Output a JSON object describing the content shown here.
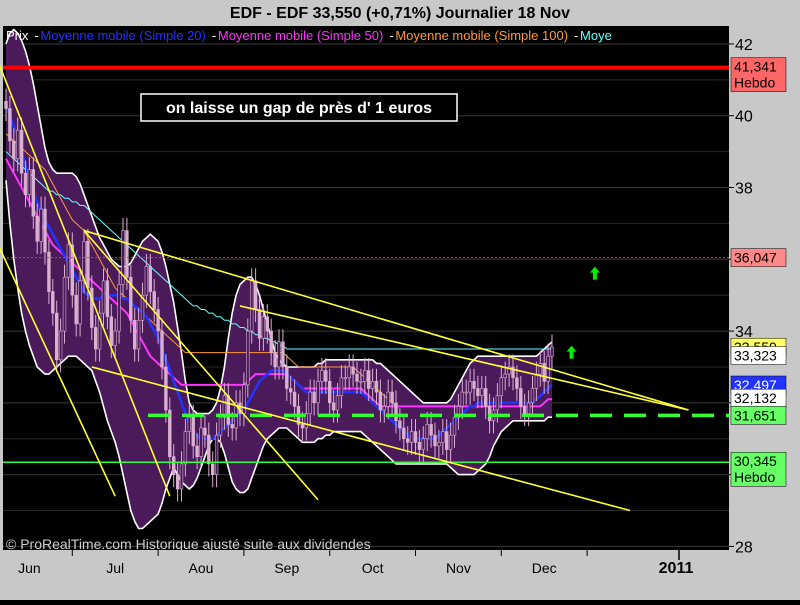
{
  "header": {
    "title": "EDF - EDF     33,550 (+0,71%)     Journalier  18 Nov"
  },
  "legend_items": [
    {
      "label": "Prix",
      "color": "#ffffff"
    },
    {
      "label": "Moyenne mobile (Simple 20)",
      "color": "#2233ff"
    },
    {
      "label": "Moyenne mobile (Simple 50)",
      "color": "#ff33ff"
    },
    {
      "label": "Moyenne mobile (Simple 100)",
      "color": "#ff9933"
    },
    {
      "label": "Moye",
      "color": "#66ffff"
    }
  ],
  "annotation": "on laisse un gap de près d' 1 euros",
  "footer": "© ProRealTime.com Historique ajusté suite aux dividendes",
  "colors": {
    "background": "#000000",
    "frame": "#c8c8c8",
    "band_fill": "#4a1a5a",
    "band_edge": "#ffffff",
    "candle": "#d9b0d0",
    "trendline": "#ffff33",
    "support": "#33ff33",
    "resistance_solid": "#ff0000",
    "resistance_dotted": "#ff3333",
    "ma20": "#2233ff",
    "ma50": "#ff33ff",
    "ma100": "#ff9933",
    "ma200": "#66ffff"
  },
  "chart_data": {
    "type": "candlestick",
    "instrument": "EDF",
    "last_price": 33.55,
    "change_pct": 0.71,
    "period": "Journalier",
    "date": "18 Nov",
    "x_tick_labels": [
      "Jun",
      "Jul",
      "Aou",
      "Sep",
      "Oct",
      "Nov",
      "Dec",
      "2011"
    ],
    "y_tick_labels": [
      "28",
      "30",
      "32",
      "34",
      "36",
      "38",
      "40",
      "42"
    ],
    "ylim": [
      27.9,
      42.5
    ],
    "price_labels": [
      {
        "value": 41.341,
        "text": "41,341",
        "sub": "Hebdo",
        "bg": "#ff6666"
      },
      {
        "value": 36.047,
        "text": "36,047",
        "sub": "",
        "bg": "#ff8888"
      },
      {
        "value": 33.55,
        "text": "33,550",
        "sub": "",
        "bg": "#ffff66"
      },
      {
        "value": 33.32,
        "text": "33,323",
        "sub": "",
        "bg": "#ffffff"
      },
      {
        "value": 32.497,
        "text": "32,497",
        "sub": "",
        "bg": "#2233ff"
      },
      {
        "value": 32.13,
        "text": "32,132",
        "sub": "",
        "bg": "#ffffff"
      },
      {
        "value": 31.651,
        "text": "31,651",
        "sub": "",
        "bg": "#66ff66"
      },
      {
        "value": 30.345,
        "text": "30,345",
        "sub": "Hebdo",
        "bg": "#66ff66"
      }
    ],
    "horizontal_levels": [
      {
        "value": 41.341,
        "style": "solid",
        "color": "#ff0000"
      },
      {
        "value": 36.047,
        "style": "dotted",
        "color": "#ff3333"
      },
      {
        "value": 30.345,
        "style": "solid",
        "color": "#33ff33"
      },
      {
        "value": 31.651,
        "style": "dashed",
        "color": "#33ff33"
      }
    ],
    "arrows": [
      {
        "period": 151,
        "value": 35.6
      },
      {
        "period": 145,
        "value": 33.4
      }
    ],
    "closes": [
      40.2,
      39.3,
      38.8,
      39.6,
      38.4,
      37.8,
      38.5,
      37.2,
      36.5,
      37.4,
      36.2,
      35.1,
      34.5,
      33.2,
      34.0,
      35.5,
      36.4,
      35.0,
      34.2,
      35.4,
      36.5,
      35.2,
      34.1,
      33.5,
      34.5,
      35.4,
      34.4,
      33.6,
      34.0,
      35.3,
      36.8,
      35.5,
      34.3,
      33.5,
      34.3,
      35.0,
      35.8,
      35.1,
      34.6,
      34.0,
      33.0,
      31.8,
      30.5,
      30.0,
      29.6,
      30.3,
      31.2,
      31.6,
      30.8,
      30.5,
      31.3,
      31.1,
      30.3,
      30.0,
      31.1,
      31.6,
      32.2,
      31.4,
      31.3,
      32.0,
      31.7,
      32.5,
      34.0,
      35.4,
      34.6,
      33.8,
      34.4,
      34.0,
      33.4,
      33.0,
      33.7,
      33.0,
      32.4,
      32.3,
      31.9,
      31.4,
      31.3,
      31.7,
      32.3,
      32.0,
      32.6,
      32.9,
      32.6,
      32.0,
      31.8,
      32.2,
      32.7,
      32.7,
      33.0,
      32.8,
      32.6,
      32.6,
      32.9,
      32.4,
      32.6,
      32.3,
      31.8,
      31.9,
      32.3,
      32.0,
      31.5,
      31.3,
      31.0,
      30.9,
      31.2,
      30.9,
      30.7,
      31.0,
      31.4,
      31.1,
      30.8,
      30.9,
      31.2,
      30.7,
      31.1,
      31.6,
      31.9,
      32.3,
      32.3,
      32.6,
      32.4,
      32.2,
      32.4,
      31.9,
      31.5,
      31.8,
      32.2,
      32.7,
      32.8,
      33.0,
      32.7,
      32.4,
      31.9,
      31.7,
      32.0,
      32.4,
      32.8,
      33.1,
      32.6,
      33.3,
      33.55
    ],
    "bollinger_upper": [
      42.0,
      42.3,
      42.4,
      42.3,
      42.1,
      41.8,
      41.4,
      40.9,
      40.3,
      39.7,
      39.1,
      38.7,
      38.5,
      38.4,
      38.4,
      38.4,
      38.4,
      38.4,
      38.3,
      38.1,
      37.8,
      37.5,
      37.2,
      36.9,
      36.6,
      36.4,
      36.2,
      36.0,
      35.9,
      35.8,
      35.8,
      35.8,
      35.9,
      36.1,
      36.3,
      36.5,
      36.6,
      36.7,
      36.6,
      36.5,
      36.2,
      35.8,
      35.3,
      34.8,
      34.1,
      33.4,
      32.6,
      32.0,
      31.8,
      31.7,
      31.7,
      31.7,
      31.7,
      31.8,
      32.0,
      32.4,
      33.0,
      33.8,
      34.5,
      35.0,
      35.3,
      35.4,
      35.5,
      35.5,
      35.3,
      35.0,
      34.6,
      34.2,
      33.8,
      33.4,
      33.2,
      33.1,
      33.0,
      33.0,
      33.0,
      33.0,
      33.0,
      33.0,
      33.0,
      33.0,
      33.1,
      33.1,
      33.2,
      33.2,
      33.2,
      33.2,
      33.2,
      33.2,
      33.2,
      33.2,
      33.2,
      33.2,
      33.2,
      33.2,
      33.2,
      33.1,
      33.1,
      33.0,
      32.9,
      32.8,
      32.7,
      32.6,
      32.5,
      32.4,
      32.3,
      32.2,
      32.1,
      32.0,
      32.0,
      32.0,
      32.0,
      32.0,
      32.0,
      32.0,
      32.1,
      32.3,
      32.5,
      32.7,
      32.9,
      33.1,
      33.2,
      33.3,
      33.3,
      33.3,
      33.3,
      33.3,
      33.3,
      33.3,
      33.3,
      33.3,
      33.3,
      33.3,
      33.3,
      33.3,
      33.3,
      33.3,
      33.3,
      33.4,
      33.5,
      33.6,
      33.7
    ],
    "bollinger_lower": [
      38.2,
      37.0,
      36.0,
      35.2,
      34.5,
      34.0,
      33.6,
      33.3,
      33.0,
      32.9,
      32.8,
      32.8,
      32.9,
      33.0,
      33.1,
      33.2,
      33.3,
      33.3,
      33.3,
      33.2,
      33.1,
      33.0,
      32.9,
      32.6,
      32.3,
      31.9,
      31.5,
      31.2,
      30.9,
      30.5,
      30.0,
      29.5,
      29.0,
      28.7,
      28.5,
      28.5,
      28.6,
      28.7,
      28.8,
      28.9,
      29.2,
      29.6,
      29.9,
      30.2,
      30.0,
      29.8,
      29.7,
      29.6,
      29.7,
      29.9,
      30.2,
      30.5,
      30.8,
      31.0,
      31.0,
      30.9,
      30.6,
      30.2,
      29.8,
      29.6,
      29.5,
      29.5,
      29.6,
      29.9,
      30.2,
      30.5,
      30.8,
      31.0,
      31.1,
      31.2,
      31.3,
      31.3,
      31.3,
      31.2,
      31.1,
      31.0,
      30.9,
      30.9,
      30.9,
      30.9,
      31.0,
      31.0,
      31.1,
      31.1,
      31.2,
      31.2,
      31.2,
      31.2,
      31.2,
      31.2,
      31.2,
      31.2,
      31.1,
      31.0,
      30.9,
      30.8,
      30.7,
      30.6,
      30.5,
      30.4,
      30.3,
      30.3,
      30.3,
      30.3,
      30.3,
      30.3,
      30.3,
      30.3,
      30.3,
      30.3,
      30.3,
      30.3,
      30.3,
      30.3,
      30.2,
      30.1,
      30.0,
      30.0,
      30.0,
      30.0,
      30.0,
      30.1,
      30.2,
      30.3,
      30.5,
      30.8,
      31.0,
      31.2,
      31.3,
      31.4,
      31.5,
      31.5,
      31.5,
      31.5,
      31.5,
      31.5,
      31.5,
      31.5,
      31.5,
      31.6,
      31.6
    ],
    "ma20": [
      40.3,
      40.0,
      39.7,
      39.4,
      39.0,
      38.6,
      38.2,
      37.9,
      37.6,
      37.3,
      37.1,
      36.9,
      36.7,
      36.5,
      36.3,
      36.1,
      35.9,
      35.7,
      35.5,
      35.3,
      35.1,
      35.0,
      34.9,
      34.9,
      34.9,
      35.0,
      35.0,
      35.0,
      35.0,
      35.0,
      34.9,
      34.9,
      34.8,
      34.7,
      34.6,
      34.5,
      34.4,
      34.2,
      34.0,
      33.8,
      33.5,
      33.2,
      32.9,
      32.6,
      32.3,
      32.0,
      31.7,
      31.4,
      31.2,
      31.1,
      31.0,
      31.0,
      31.0,
      31.0,
      31.1,
      31.2,
      31.3,
      31.4,
      31.5,
      31.6,
      31.7,
      31.8,
      32.0,
      32.2,
      32.4,
      32.6,
      32.7,
      32.8,
      32.9,
      32.9,
      32.9,
      32.9,
      32.8,
      32.7,
      32.6,
      32.5,
      32.4,
      32.3,
      32.3,
      32.3,
      32.3,
      32.3,
      32.3,
      32.3,
      32.3,
      32.3,
      32.3,
      32.3,
      32.3,
      32.3,
      32.3,
      32.3,
      32.2,
      32.1,
      32.0,
      31.9,
      31.8,
      31.7,
      31.6,
      31.5,
      31.4,
      31.3,
      31.2,
      31.1,
      31.0,
      31.0,
      31.0,
      31.0,
      31.0,
      31.0,
      31.0,
      31.1,
      31.2,
      31.3,
      31.4,
      31.5,
      31.6,
      31.7,
      31.8,
      31.9,
      31.9,
      32.0,
      32.0,
      32.0,
      32.0,
      32.0,
      32.0,
      32.0,
      32.0,
      32.0,
      32.0,
      32.0,
      32.0,
      32.0,
      32.0,
      32.0,
      32.1,
      32.2,
      32.3,
      32.4,
      32.5
    ],
    "ma50": [
      38.8,
      38.6,
      38.4,
      38.2,
      38.0,
      37.8,
      37.6,
      37.4,
      37.2,
      37.0,
      36.8,
      36.6,
      36.4,
      36.3,
      36.2,
      36.1,
      36.0,
      35.9,
      35.8,
      35.7,
      35.6,
      35.5,
      35.4,
      35.3,
      35.2,
      35.1,
      35.0,
      34.9,
      34.8,
      34.7,
      34.6,
      34.5,
      34.3,
      34.1,
      33.9,
      33.7,
      33.5,
      33.3,
      33.2,
      33.1,
      33.0,
      32.9,
      32.8,
      32.7,
      32.6,
      32.5,
      32.5,
      32.5,
      32.5,
      32.5,
      32.5,
      32.5,
      32.5,
      32.5,
      32.5,
      32.5,
      32.5,
      32.5,
      32.5,
      32.5,
      32.5,
      32.5,
      32.6,
      32.7,
      32.8,
      32.8,
      32.8,
      32.8,
      32.8,
      32.8,
      32.8,
      32.8,
      32.8,
      32.7,
      32.6,
      32.5,
      32.4,
      32.4,
      32.4,
      32.4,
      32.4,
      32.4,
      32.4,
      32.4,
      32.4,
      32.4,
      32.4,
      32.4,
      32.4,
      32.4,
      32.4,
      32.4,
      32.3,
      32.2,
      32.1,
      32.0,
      31.9,
      31.9,
      31.9,
      31.9,
      31.9,
      31.9,
      31.9,
      31.9,
      31.9,
      31.9,
      31.9,
      31.9,
      31.9,
      31.9,
      31.9,
      31.9,
      31.9,
      31.9,
      31.9,
      31.9,
      31.9,
      31.9,
      31.9,
      31.9,
      31.9,
      31.9,
      31.9,
      31.9,
      31.9,
      31.9,
      31.9,
      31.9,
      31.9,
      31.9,
      31.9,
      31.9,
      31.9,
      31.9,
      31.9,
      31.9,
      31.9,
      31.9,
      32.0,
      32.1,
      32.1
    ],
    "ma100": [
      39.5,
      39.4,
      39.3,
      39.2,
      39.1,
      39.0,
      38.9,
      38.8,
      38.7,
      38.6,
      38.5,
      38.3,
      38.1,
      37.9,
      37.7,
      37.5,
      37.3,
      37.1,
      37.0,
      36.9,
      36.8,
      36.6,
      36.4,
      36.2,
      36.0,
      35.8,
      35.6,
      35.4,
      35.2,
      35.1,
      35.0,
      34.9,
      34.8,
      34.7,
      34.6,
      34.5,
      34.4,
      34.3,
      34.2,
      34.1,
      34.0,
      33.9,
      33.8,
      33.7,
      33.6,
      33.5,
      33.4,
      33.4,
      33.4,
      33.4,
      33.4,
      33.4,
      33.4,
      33.4,
      33.4,
      33.4,
      33.4,
      33.4,
      33.4,
      33.4,
      33.4,
      33.4,
      33.4,
      33.4,
      33.4,
      33.4,
      33.4,
      33.4,
      33.4,
      33.4,
      33.4,
      33.4,
      33.3,
      33.2,
      33.1,
      33.0,
      33.0,
      33.0,
      33.0,
      33.0,
      33.0,
      33.0,
      33.0,
      33.0,
      33.0,
      33.0,
      33.0,
      33.0,
      33.0,
      33.0,
      32.9,
      32.8,
      32.7,
      32.6,
      32.5,
      32.4,
      32.3,
      32.2,
      32.1,
      32.0,
      31.9,
      31.9,
      31.9,
      31.9,
      31.9,
      31.9,
      31.9,
      31.9,
      31.9,
      31.9,
      31.9,
      31.9,
      31.9,
      31.9,
      31.9,
      31.9,
      31.9,
      31.9,
      31.9,
      31.9,
      31.9,
      31.9,
      31.9,
      31.9,
      31.9,
      31.9,
      31.9,
      31.9,
      31.9,
      31.9,
      31.9,
      31.9,
      31.9,
      31.9,
      31.9,
      31.9,
      31.9,
      31.9,
      32.0,
      32.1,
      32.1
    ],
    "ma200": [
      39.0,
      38.9,
      38.8,
      38.7,
      38.6,
      38.5,
      38.4,
      38.3,
      38.2,
      38.1,
      38.0,
      37.9,
      37.9,
      37.8,
      37.8,
      37.7,
      37.7,
      37.6,
      37.6,
      37.5,
      37.5,
      37.4,
      37.3,
      37.2,
      37.1,
      37.0,
      36.9,
      36.8,
      36.7,
      36.6,
      36.5,
      36.4,
      36.3,
      36.2,
      36.1,
      36.0,
      35.9,
      35.8,
      35.7,
      35.6,
      35.5,
      35.4,
      35.3,
      35.2,
      35.1,
      35.0,
      34.9,
      34.8,
      34.7,
      34.7,
      34.6,
      34.6,
      34.5,
      34.5,
      34.4,
      34.4,
      34.3,
      34.3,
      34.2,
      34.2,
      34.1,
      34.1,
      34.0,
      34.0,
      33.9,
      33.9,
      33.8,
      33.8,
      33.7,
      33.7,
      33.6,
      33.6,
      33.5,
      33.5,
      33.5,
      33.5,
      33.5,
      33.5,
      33.5,
      33.5,
      33.5,
      33.5,
      33.5,
      33.5,
      33.5,
      33.5,
      33.5,
      33.5,
      33.5,
      33.5,
      33.5,
      33.5,
      33.5,
      33.5,
      33.5,
      33.5,
      33.5,
      33.5,
      33.5,
      33.5,
      33.5,
      33.5,
      33.5,
      33.5,
      33.5,
      33.5,
      33.5,
      33.5,
      33.5,
      33.5,
      33.5,
      33.5,
      33.5,
      33.5,
      33.5,
      33.5,
      33.5,
      33.5,
      33.5,
      33.5,
      33.5,
      33.5,
      33.5,
      33.5,
      33.5,
      33.5,
      33.5,
      33.5,
      33.5,
      33.5,
      33.5,
      33.5,
      33.5,
      33.5,
      33.5,
      33.5,
      33.5,
      33.5,
      33.5,
      33.5,
      33.5
    ],
    "trendlines": [
      {
        "x1": -2,
        "y1": 41.5,
        "x2": 42,
        "y2": 29.4
      },
      {
        "x1": -2,
        "y1": 36.4,
        "x2": 28,
        "y2": 29.4
      },
      {
        "x1": 20,
        "y1": 36.8,
        "x2": 80,
        "y2": 29.3
      },
      {
        "x1": 20,
        "y1": 36.8,
        "x2": 175,
        "y2": 31.8
      },
      {
        "x1": 22,
        "y1": 33.0,
        "x2": 160,
        "y2": 29.0
      },
      {
        "x1": 60,
        "y1": 34.7,
        "x2": 175,
        "y2": 31.8
      }
    ]
  }
}
